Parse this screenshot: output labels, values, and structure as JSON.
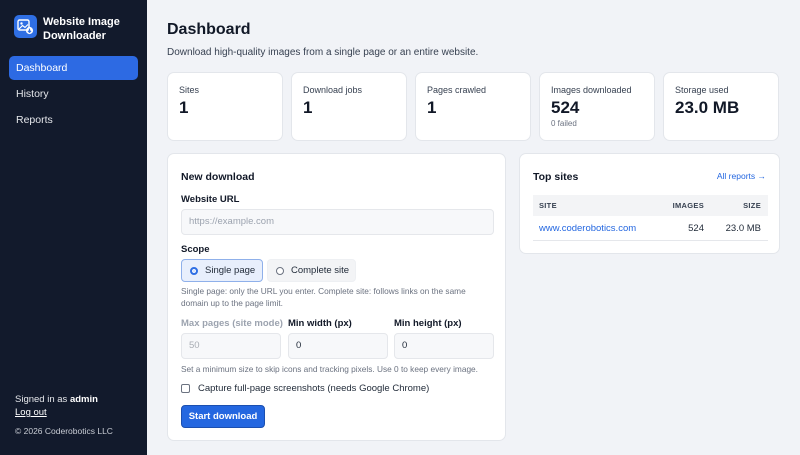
{
  "app": {
    "name": "Website Image Downloader"
  },
  "sidebar": {
    "items": [
      {
        "label": "Dashboard",
        "active": true
      },
      {
        "label": "History",
        "active": false
      },
      {
        "label": "Reports",
        "active": false
      }
    ],
    "signed_in_prefix": "Signed in as",
    "username": "admin",
    "logout_label": "Log out",
    "copyright": "© 2026 Coderobotics LLC"
  },
  "header": {
    "title": "Dashboard",
    "subtitle": "Download high-quality images from a single page or an entire website."
  },
  "stats": [
    {
      "label": "Sites",
      "value": "1",
      "sub": ""
    },
    {
      "label": "Download jobs",
      "value": "1",
      "sub": ""
    },
    {
      "label": "Pages crawled",
      "value": "1",
      "sub": ""
    },
    {
      "label": "Images downloaded",
      "value": "524",
      "sub": "0 failed"
    },
    {
      "label": "Storage used",
      "value": "23.0 MB",
      "sub": ""
    }
  ],
  "new_download": {
    "title": "New download",
    "url_label": "Website URL",
    "url_placeholder": "https://example.com",
    "scope_label": "Scope",
    "scope_options": [
      {
        "label": "Single page",
        "selected": true
      },
      {
        "label": "Complete site",
        "selected": false
      }
    ],
    "scope_help_1": "Single page: only the URL you enter. Complete site: follows links on the same",
    "scope_help_2": "domain up to the page limit.",
    "max_pages_label": "Max pages (site mode)",
    "max_pages_value": "50",
    "min_width_label": "Min width (px)",
    "min_width_value": "0",
    "min_height_label": "Min height (px)",
    "min_height_value": "0",
    "size_help": "Set a minimum size to skip icons and tracking pixels. Use 0 to keep every image.",
    "screenshot_label": "Capture full-page screenshots (needs Google Chrome)",
    "submit_label": "Start download"
  },
  "top_sites": {
    "title": "Top sites",
    "all_reports_label": "All reports →",
    "columns": [
      "SITE",
      "IMAGES",
      "SIZE"
    ],
    "rows": [
      {
        "site": "www.coderobotics.com",
        "images": "524",
        "size": "23.0 MB"
      }
    ]
  },
  "colors": {
    "sidebar_bg": "#121a2c",
    "accent": "#2d6ae3",
    "page_bg": "#f1f3f7"
  }
}
